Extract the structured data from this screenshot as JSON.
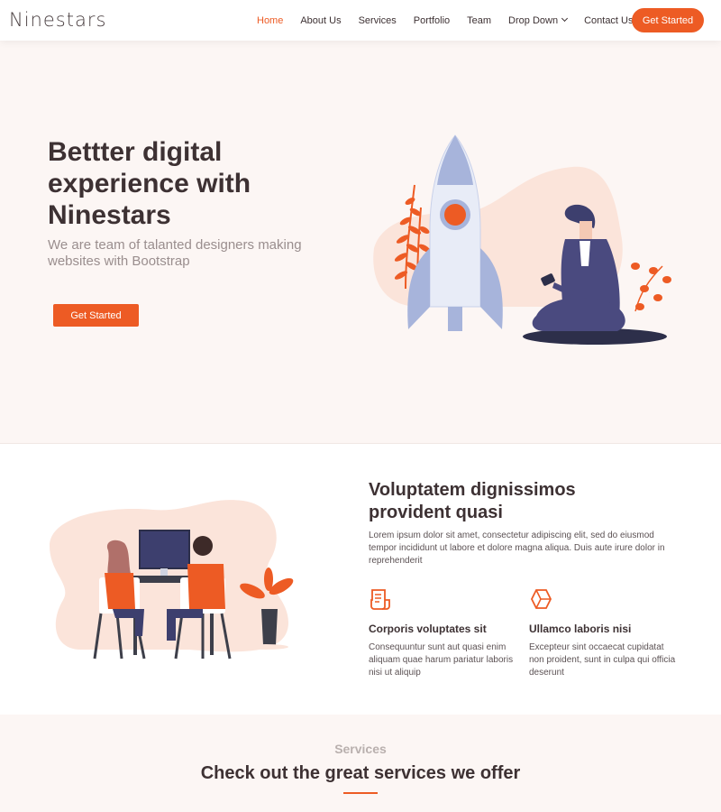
{
  "brand": "Ninestars",
  "nav": {
    "items": [
      {
        "label": "Home",
        "active": true
      },
      {
        "label": "About Us"
      },
      {
        "label": "Services"
      },
      {
        "label": "Portfolio"
      },
      {
        "label": "Team"
      },
      {
        "label": "Drop Down",
        "has_dropdown": true
      },
      {
        "label": "Contact Us"
      }
    ],
    "cta": "Get Started"
  },
  "hero": {
    "title": "Bettter digital experience with Ninestars",
    "subtitle": "We are team of talanted designers making websites with Bootstrap",
    "button": "Get Started"
  },
  "about": {
    "title": "Voluptatem dignissimos provident quasi",
    "text": "Lorem ipsum dolor sit amet, consectetur adipiscing elit, sed do eiusmod tempor incididunt ut labore et dolore magna aliqua. Duis aute irure dolor in reprehenderit",
    "features": [
      {
        "icon": "receipt-icon",
        "title": "Corporis voluptates sit",
        "text": "Consequuntur sunt aut quasi enim aliquam quae harum pariatur laboris nisi ut aliquip"
      },
      {
        "icon": "cube-icon",
        "title": "Ullamco laboris nisi",
        "text": "Excepteur sint occaecat cupidatat non proident, sunt in culpa qui officia deserunt"
      }
    ]
  },
  "services": {
    "label": "Services",
    "heading": "Check out the great services we offer"
  },
  "colors": {
    "accent": "#ed5b24",
    "hero_bg": "#fcf6f4",
    "text_dark": "#3d3133"
  }
}
